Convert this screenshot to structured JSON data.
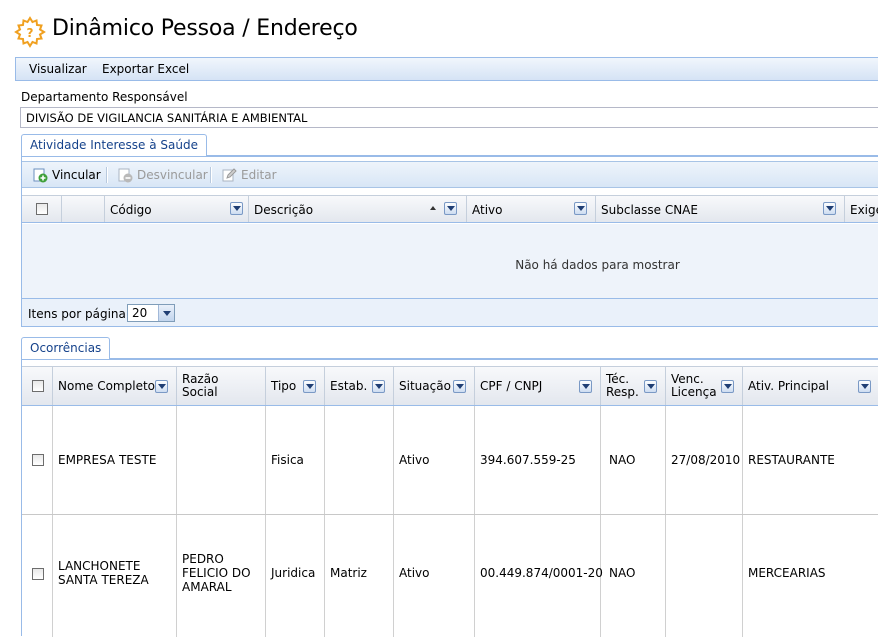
{
  "page": {
    "title": "Dinâmico Pessoa / Endereço"
  },
  "menu": {
    "items": [
      "Visualizar",
      "Exportar Excel"
    ]
  },
  "department": {
    "label": "Departamento Responsável",
    "value": "DIVISÃO DE VIGILANCIA SANITÁRIA E AMBIENTAL"
  },
  "tabs1": {
    "active": "Atividade Interesse à Saúde"
  },
  "toolbar": {
    "vincular": "Vincular",
    "desvincular": "Desvincular",
    "editar": "Editar"
  },
  "grid1": {
    "columns": [
      "Código",
      "Descrição",
      "Ativo",
      "Subclasse CNAE",
      "Exige"
    ],
    "empty_message": "Não há dados para mostrar",
    "pager_label": "Itens por página:",
    "page_size": "20"
  },
  "tabs2": {
    "active": "Ocorrências"
  },
  "grid2": {
    "columns": [
      [
        "Nome Completo"
      ],
      [
        "Razão",
        "Social"
      ],
      [
        "Tipo"
      ],
      [
        "Estab."
      ],
      [
        "Situação"
      ],
      [
        "CPF / CNPJ"
      ],
      [
        "Téc.",
        "Resp."
      ],
      [
        "Venc.",
        "Licença"
      ],
      [
        "Ativ. Principal"
      ]
    ],
    "rows": [
      {
        "nome": [
          "EMPRESA TESTE"
        ],
        "razao": [],
        "tipo": "Fisica",
        "estab": "",
        "situacao": "Ativo",
        "cpf": "394.607.559-25",
        "tec": "NAO",
        "venc": "27/08/2010",
        "ativ": "RESTAURANTE"
      },
      {
        "nome": [
          "LANCHONETE",
          "SANTA TEREZA"
        ],
        "razao": [
          "PEDRO",
          "FELICIO DO",
          "AMARAL"
        ],
        "tipo": "Juridica",
        "estab": "Matriz",
        "situacao": "Ativo",
        "cpf": "00.449.874/0001-20",
        "tec": "NAO",
        "venc": "",
        "ativ": "MERCEARIAS"
      }
    ]
  },
  "colors": {
    "accent": "#15428b",
    "border": "#99bbe8",
    "icon": "#f0a020"
  },
  "icons": [
    "gear-question-icon",
    "add-link-icon",
    "remove-link-icon",
    "edit-icon",
    "chevron-down-icon",
    "sort-asc-icon"
  ]
}
